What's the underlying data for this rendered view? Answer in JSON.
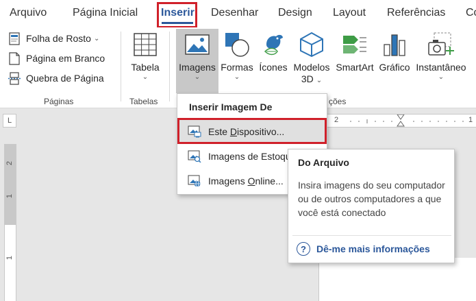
{
  "tabs": [
    {
      "label": "Arquivo",
      "active": false
    },
    {
      "label": "Página Inicial",
      "active": false
    },
    {
      "label": "Inserir",
      "active": true
    },
    {
      "label": "Desenhar",
      "active": false
    },
    {
      "label": "Design",
      "active": false
    },
    {
      "label": "Layout",
      "active": false
    },
    {
      "label": "Referências",
      "active": false
    },
    {
      "label": "Co",
      "active": false
    }
  ],
  "ribbon": {
    "paginas": {
      "label": "Páginas",
      "folha_de_rosto": "Folha de Rosto",
      "pagina_em_branco": "Página em Branco",
      "quebra_de_pagina": "Quebra de Página"
    },
    "tabelas": {
      "label": "Tabelas",
      "tabela": "Tabela"
    },
    "ilustracoes": {
      "label_partial": "ções",
      "imagens": "Imagens",
      "formas": "Formas",
      "icones": "Ícones",
      "modelos_3d_line1": "Modelos",
      "modelos_3d_line2": "3D",
      "smartart": "SmartArt",
      "grafico": "Gráfico",
      "instantaneo": "Instantâneo"
    }
  },
  "ruler": {
    "h_numbers": [
      "2",
      "1"
    ],
    "v_numbers": [
      "2",
      "1",
      "1"
    ],
    "corner_glyph": "L"
  },
  "dropdown": {
    "header": "Inserir Imagem De",
    "items": [
      {
        "label": "Este ",
        "accel": "D",
        "rest": "ispositivo...",
        "icon": "device-image-icon"
      },
      {
        "label": "Imagens de Estoque...",
        "icon": "stock-images-icon"
      },
      {
        "label": "Imagens ",
        "accel": "O",
        "rest": "nline...",
        "icon": "online-images-icon"
      }
    ]
  },
  "tooltip": {
    "title": "Do Arquivo",
    "body": "Insira imagens do seu computador ou de outros computadores a que você está conectado",
    "link": "Dê-me mais informações"
  },
  "colors": {
    "accent": "#2b579a",
    "highlight": "#d0202a",
    "icon_blue": "#2e75b6",
    "icon_green": "#3e9c46"
  }
}
